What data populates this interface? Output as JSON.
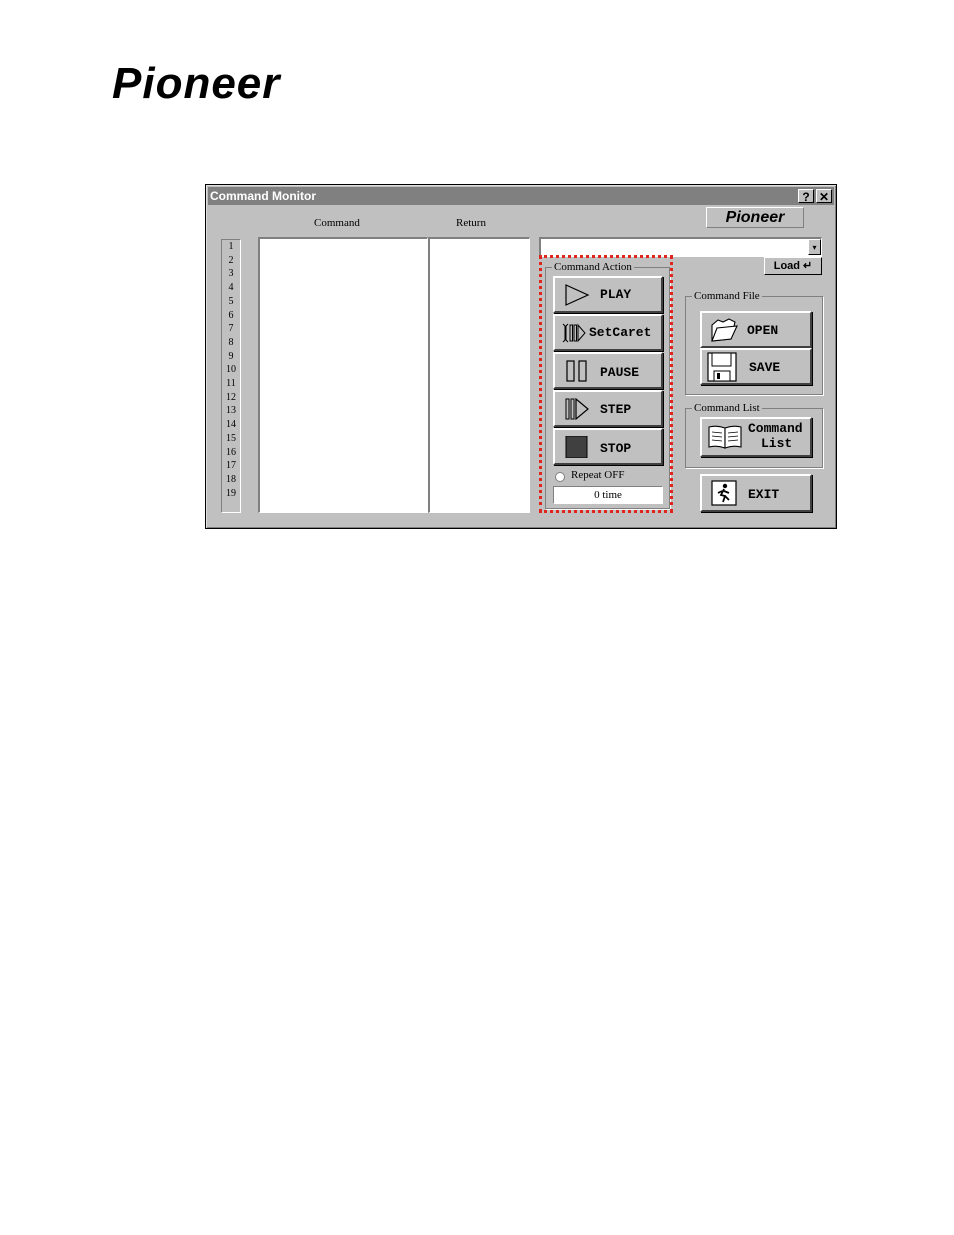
{
  "brand": {
    "logo_text": "Pioneer"
  },
  "window": {
    "title": "Command Monitor",
    "help_label": "?",
    "close_label": "✕",
    "brand_badge": "Pioneer"
  },
  "columns": {
    "command_header": "Command",
    "return_header": "Return"
  },
  "line_numbers": [
    "1",
    "2",
    "3",
    "4",
    "5",
    "6",
    "7",
    "8",
    "9",
    "10",
    "11",
    "12",
    "13",
    "14",
    "15",
    "16",
    "17",
    "18",
    "19"
  ],
  "combo": {
    "value": "",
    "arrow": "▾"
  },
  "load_button": {
    "label": "Load ↵"
  },
  "command_action": {
    "title": "Command Action",
    "buttons": [
      {
        "label": "PLAY",
        "icon": "play-icon"
      },
      {
        "label": "SetCaret",
        "icon": "setcaret-icon"
      },
      {
        "label": "PAUSE",
        "icon": "pause-icon"
      },
      {
        "label": "STEP",
        "icon": "step-icon"
      },
      {
        "label": "STOP",
        "icon": "stop-icon"
      }
    ],
    "repeat_label": "Repeat OFF",
    "repeat_time": "0 time"
  },
  "command_file": {
    "title": "Command File",
    "open_label": "OPEN",
    "save_label": "SAVE"
  },
  "command_list": {
    "title": "Command List",
    "label_line1": "Command",
    "label_line2": "List"
  },
  "exit_button": {
    "label": "EXIT"
  },
  "colors": {
    "highlight": "#e0261c",
    "face": "#c0c0c0",
    "titlebar": "#808080"
  }
}
